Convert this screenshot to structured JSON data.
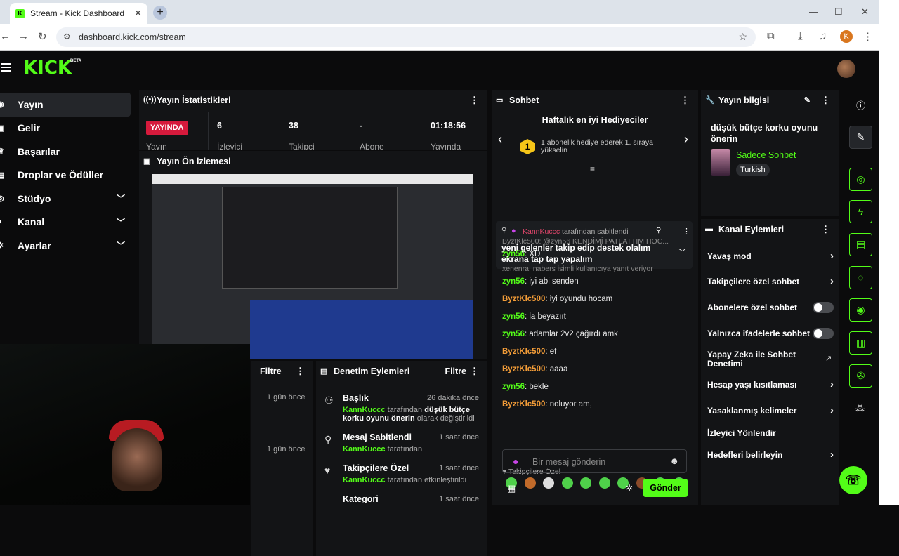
{
  "browser": {
    "tab_title": "Stream - Kick Dashboard",
    "url": "dashboard.kick.com/stream",
    "profile_initial": "K"
  },
  "kick": {
    "logo": "KICK",
    "beta": "BETA"
  },
  "sidebar": {
    "items": [
      {
        "label": "Yayın",
        "icon": "broadcast-icon"
      },
      {
        "label": "Gelir",
        "icon": "wallet-icon"
      },
      {
        "label": "Başarılar",
        "icon": "trophy-icon"
      },
      {
        "label": "Droplar ve Ödüller",
        "icon": "gift-icon"
      },
      {
        "label": "Stüdyo",
        "icon": "camera-icon"
      },
      {
        "label": "Kanal",
        "icon": "user-icon"
      },
      {
        "label": "Ayarlar",
        "icon": "gear-icon"
      }
    ]
  },
  "stats": {
    "title": "Yayın İstatistikleri",
    "live": "YAYINDA",
    "live_sub": "Yayın",
    "items": [
      {
        "value": "6",
        "label": "İzleyici"
      },
      {
        "value": "38",
        "label": "Takipçi"
      },
      {
        "value": "-",
        "label": "Abone"
      },
      {
        "value": "01:18:56",
        "label": "Yayında"
      }
    ]
  },
  "preview": {
    "title": "Yayın Ön İzlemesi"
  },
  "filter": {
    "label": "Filtre",
    "times": [
      "1 gün önce",
      "1 gün önce"
    ]
  },
  "modlog": {
    "title": "Denetim Eylemleri",
    "filter": "Filtre",
    "items": [
      {
        "title": "Başlık",
        "time": "26 dakika önce",
        "user": "KannKuccc",
        "pre": " tarafından ",
        "bold": "düşük bütçe korku oyunu önerin",
        "post": " olarak değiştirildi"
      },
      {
        "title": "Mesaj Sabitlendi",
        "time": "1 saat önce",
        "user": "KannKuccc",
        "pre": " tarafından",
        "bold": "",
        "post": ""
      },
      {
        "title": "Takipçilere Özel",
        "time": "1 saat önce",
        "user": "KannKuccc",
        "pre": " tarafından etkinleştirildi",
        "bold": "",
        "post": ""
      },
      {
        "title": "Kategori",
        "time": "1 saat önce",
        "user": "",
        "pre": "",
        "bold": "",
        "post": ""
      }
    ]
  },
  "chat": {
    "title": "Sohbet",
    "gifters_title": "Haftalık en iyi Hediyeciler",
    "gifter_rank": "1",
    "gifter_text": "1 abonelik hediye ederek 1. sıraya yükselin",
    "pinned": {
      "user": "KannKuccc",
      "by": " tarafından sabitlendi",
      "text": "yeni gelenler takip edip destek olalım ekrana tap tap yapalım"
    },
    "messages": [
      {
        "type": "reply",
        "text": "ByztKlc500: @zyn56 KENDİMİ PATLATTIM HOC..."
      },
      {
        "type": "msg",
        "user": "zyn56",
        "cls": "u1",
        "text": "XD"
      },
      {
        "type": "reply",
        "text": "xenenra: nabers isimli kullanıcıya yanıt veriyor"
      },
      {
        "type": "msg",
        "user": "zyn56",
        "cls": "u1",
        "text": "iyi abi senden"
      },
      {
        "type": "msg",
        "user": "ByztKlc500",
        "cls": "u2",
        "text": "iyi oyundu hocam"
      },
      {
        "type": "msg",
        "user": "zyn56",
        "cls": "u1",
        "text": "la beyazııt"
      },
      {
        "type": "msg",
        "user": "zyn56",
        "cls": "u1",
        "text": "adamlar 2v2 çağırdı amk"
      },
      {
        "type": "msg",
        "user": "ByztKlc500",
        "cls": "u2",
        "text": "ef"
      },
      {
        "type": "msg",
        "user": "ByztKlc500",
        "cls": "u2",
        "text": "aaaa"
      },
      {
        "type": "msg",
        "user": "zyn56",
        "cls": "u1",
        "text": "bekle"
      },
      {
        "type": "msg",
        "user": "ByztKlc500",
        "cls": "u2",
        "text": "noluyor am,"
      }
    ],
    "followers_only": "Takipçilere Özel",
    "input_placeholder": "Bir mesaj gönderin",
    "send": "Gönder"
  },
  "info": {
    "title": "Yayın bilgisi",
    "stream_title": "düşük bütçe korku oyunu önerin",
    "category": "Sadece Sohbet",
    "language": "Turkish"
  },
  "channel_actions": {
    "title": "Kanal Eylemleri",
    "rows": [
      {
        "label": "Yavaş mod",
        "kind": "arrow"
      },
      {
        "label": "Takipçilere özel sohbet",
        "kind": "arrow"
      },
      {
        "label": "Abonelere özel sohbet",
        "kind": "toggle"
      },
      {
        "label": "Yalnızca ifadelerle sohbet",
        "kind": "toggle"
      },
      {
        "label": "Yapay Zeka ile Sohbet Denetimi",
        "kind": "ext"
      },
      {
        "label": "Hesap yaşı kısıtlaması",
        "kind": "arrow"
      },
      {
        "label": "Yasaklanmış kelimeler",
        "kind": "arrow"
      },
      {
        "label": "İzleyici Yönlendir",
        "kind": "none"
      },
      {
        "label": "Hedefleri belirleyin",
        "kind": "arrow"
      }
    ]
  }
}
